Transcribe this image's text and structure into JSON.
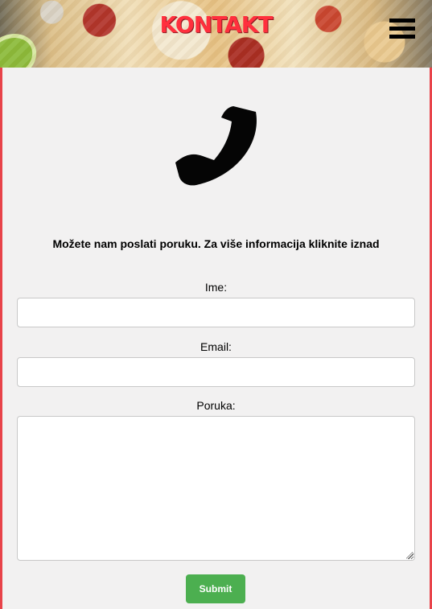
{
  "header": {
    "title": "KONTAKT",
    "menu_icon": "hamburger-menu-icon",
    "hero_image": "pizza-banner"
  },
  "contact": {
    "icon": "phone-icon",
    "message": "Možete nam poslati poruku. Za više informacija kliknite iznad"
  },
  "form": {
    "name_label": "Ime:",
    "name_value": "",
    "email_label": "Email:",
    "email_value": "",
    "message_label": "Poruka:",
    "message_value": "",
    "submit_label": "Submit"
  },
  "colors": {
    "accent_red": "#ff2f3d",
    "border_red": "#e8434a",
    "submit_green": "#4caf50",
    "page_background": "#f2f1f1"
  }
}
